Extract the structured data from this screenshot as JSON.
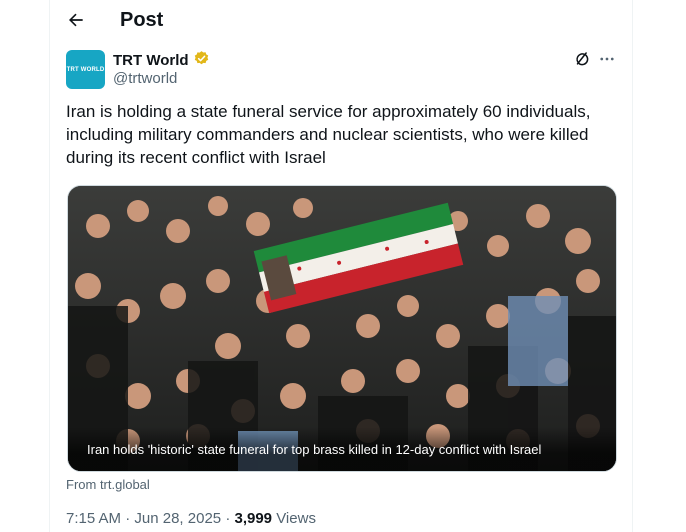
{
  "header": {
    "back_icon": "arrow-left-icon",
    "title": "Post"
  },
  "author": {
    "name": "TRT World",
    "handle": "@trtworld",
    "avatar_label": "TRT WORLD",
    "avatar_color": "#17a6c4",
    "verified_color": "#e2b719"
  },
  "actions": {
    "grok_icon": "grok-icon",
    "more_icon": "more-horizontal-icon"
  },
  "tweet": {
    "text": "Iran is holding a state funeral service for approximately 60 individuals, including military commanders and nuclear scientists, who were killed during its recent conflict with Israel"
  },
  "media": {
    "caption": "Iran holds 'historic' state funeral for top brass killed in 12-day conflict with Israel"
  },
  "source": {
    "text": "From trt.global"
  },
  "meta": {
    "time": "7:15 AM",
    "separator": "·",
    "date": "Jun 28, 2025",
    "views_count": "3,999",
    "views_label": "Views"
  }
}
